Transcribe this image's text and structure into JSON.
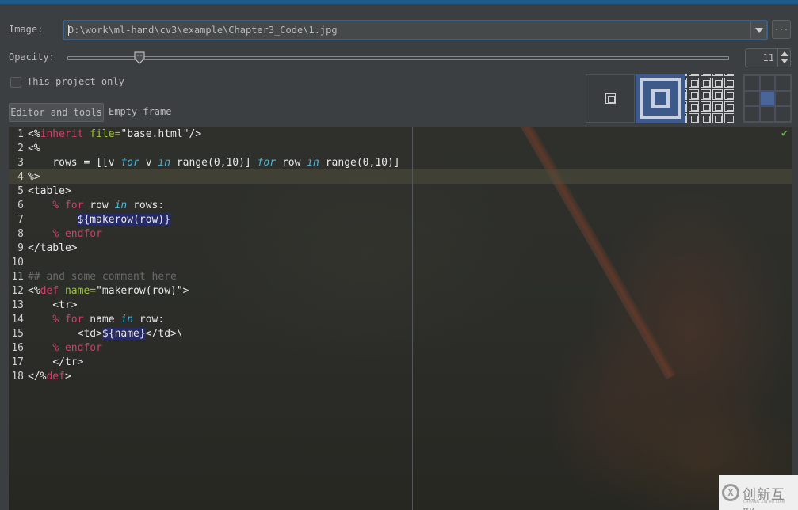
{
  "form": {
    "image_label": "Image:",
    "image_path": "D:\\work\\ml-hand\\cv3\\example\\Chapter3_Code\\1.jpg",
    "browse_label": "...",
    "opacity_label": "Opacity:",
    "opacity_value": "11",
    "opacity_percent": 11,
    "project_only_label": "This project only",
    "project_only_checked": false
  },
  "image_style_options": [
    {
      "name": "center",
      "selected": false
    },
    {
      "name": "scale",
      "selected": true
    },
    {
      "name": "tile",
      "selected": false
    }
  ],
  "anchor": {
    "selected": "center"
  },
  "tabs": [
    {
      "label": "Editor and tools",
      "active": true
    },
    {
      "label": "Empty frame",
      "active": false
    }
  ],
  "editor": {
    "status_icon": "check-icon",
    "status_symbol": "✔",
    "current_line": 4,
    "lines": [
      {
        "n": "1",
        "tokens": [
          [
            "plain",
            "<%"
          ],
          [
            "kw",
            "inherit"
          ],
          [
            "plain",
            " "
          ],
          [
            "attr",
            "file="
          ],
          [
            "str",
            "\"base.html\"/>"
          ]
        ]
      },
      {
        "n": "2",
        "tokens": [
          [
            "plain",
            "<%"
          ]
        ]
      },
      {
        "n": "3",
        "tokens": [
          [
            "plain",
            "    rows = [[v "
          ],
          [
            "it",
            "for"
          ],
          [
            "plain",
            " v "
          ],
          [
            "it",
            "in"
          ],
          [
            "plain",
            " range(0,10)] "
          ],
          [
            "it",
            "for"
          ],
          [
            "plain",
            " row "
          ],
          [
            "it",
            "in"
          ],
          [
            "plain",
            " range(0,10)]"
          ]
        ]
      },
      {
        "n": "4",
        "tokens": [
          [
            "plain",
            "%>"
          ]
        ]
      },
      {
        "n": "5",
        "tokens": [
          [
            "plain",
            "<table>"
          ]
        ]
      },
      {
        "n": "6",
        "tokens": [
          [
            "plain",
            "    "
          ],
          [
            "kw",
            "% for"
          ],
          [
            "plain",
            " row "
          ],
          [
            "it",
            "in"
          ],
          [
            "plain",
            " rows:"
          ]
        ]
      },
      {
        "n": "7",
        "tokens": [
          [
            "plain",
            "        "
          ],
          [
            "hl",
            "${makerow(row)}"
          ]
        ]
      },
      {
        "n": "8",
        "tokens": [
          [
            "plain",
            "    "
          ],
          [
            "kw",
            "% endfor"
          ]
        ]
      },
      {
        "n": "9",
        "tokens": [
          [
            "plain",
            "</table>"
          ]
        ]
      },
      {
        "n": "10",
        "tokens": []
      },
      {
        "n": "11",
        "tokens": [
          [
            "com",
            "## and some comment here"
          ]
        ]
      },
      {
        "n": "12",
        "tokens": [
          [
            "plain",
            "<%"
          ],
          [
            "kw",
            "def"
          ],
          [
            "plain",
            " "
          ],
          [
            "attr",
            "name="
          ],
          [
            "str",
            "\"makerow(row)\">"
          ]
        ]
      },
      {
        "n": "13",
        "tokens": [
          [
            "plain",
            "    <tr>"
          ]
        ]
      },
      {
        "n": "14",
        "tokens": [
          [
            "plain",
            "    "
          ],
          [
            "kw",
            "% for"
          ],
          [
            "plain",
            " name "
          ],
          [
            "it",
            "in"
          ],
          [
            "plain",
            " row:"
          ]
        ]
      },
      {
        "n": "15",
        "tokens": [
          [
            "plain",
            "        <td>"
          ],
          [
            "hl",
            "${name}"
          ],
          [
            "plain",
            "</td>\\"
          ]
        ]
      },
      {
        "n": "16",
        "tokens": [
          [
            "plain",
            "    "
          ],
          [
            "kw",
            "% endfor"
          ]
        ]
      },
      {
        "n": "17",
        "tokens": [
          [
            "plain",
            "    </tr>"
          ]
        ]
      },
      {
        "n": "18",
        "tokens": [
          [
            "plain",
            "</%"
          ],
          [
            "kw",
            "def"
          ],
          [
            "plain",
            ">"
          ]
        ]
      }
    ]
  },
  "watermark": {
    "text": "创新互联",
    "sub": "CHUANG XIN HU LIAN",
    "logo": "X"
  },
  "colors": {
    "accent": "#1f5b8a",
    "keyword": "#cf3f6a",
    "attribute": "#9fc23b",
    "italic_keyword": "#4fb5d3",
    "highlight": "#262a66",
    "ok": "#5fb34a"
  }
}
